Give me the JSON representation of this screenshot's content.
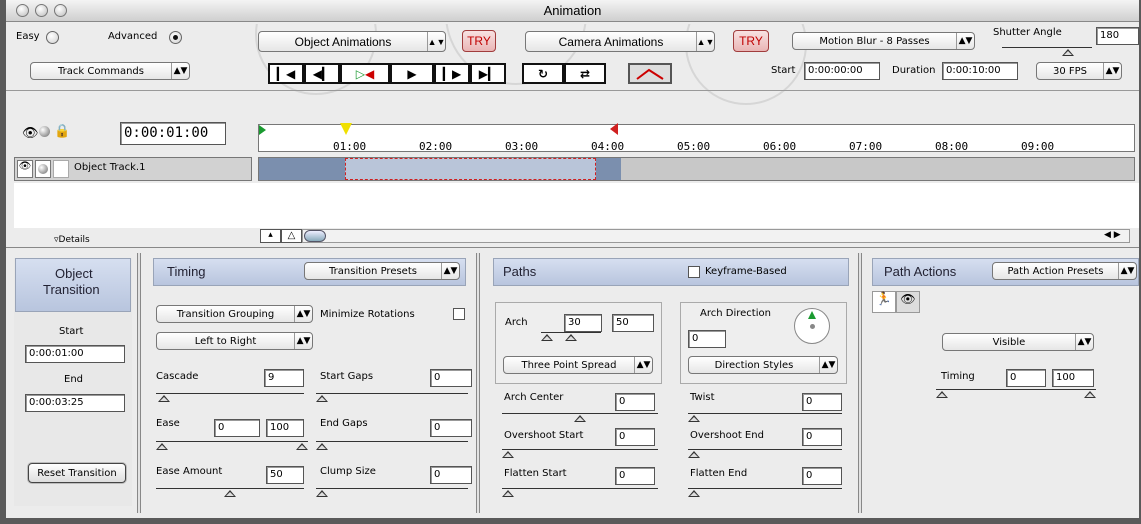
{
  "window": {
    "title": "Animation"
  },
  "mode": {
    "easy_label": "Easy",
    "advanced_label": "Advanced",
    "selected": "Advanced"
  },
  "toolbar": {
    "object_animations": "Object Animations",
    "camera_animations": "Camera Animations",
    "try_label": "TRY",
    "motion_blur": "Motion Blur - 8 Passes",
    "shutter_angle_label": "Shutter Angle",
    "shutter_angle_value": "180",
    "track_commands": "Track Commands",
    "start_label": "Start",
    "start_value": "0:00:00:00",
    "duration_label": "Duration",
    "duration_value": "0:00:10:00",
    "fps": "30 FPS"
  },
  "timeline": {
    "current_time": "0:00:01:00",
    "ticks": [
      "01:00",
      "02:00",
      "03:00",
      "04:00",
      "05:00",
      "06:00",
      "07:00",
      "08:00",
      "09:00"
    ],
    "track_name": "Object Track.1",
    "details_label": "Details"
  },
  "object_transition": {
    "title_line1": "Object",
    "title_line2": "Transition",
    "start_label": "Start",
    "start_value": "0:00:01:00",
    "end_label": "End",
    "end_value": "0:00:03:25",
    "reset_button": "Reset Transition"
  },
  "timing": {
    "title": "Timing",
    "presets": "Transition Presets",
    "grouping": "Transition Grouping",
    "minimize_rotations": "Minimize Rotations",
    "order": "Left to Right",
    "cascade_label": "Cascade",
    "cascade_value": "9",
    "start_gaps_label": "Start Gaps",
    "start_gaps_value": "0",
    "ease_label": "Ease",
    "ease_value_a": "0",
    "ease_value_b": "100",
    "end_gaps_label": "End Gaps",
    "end_gaps_value": "0",
    "ease_amount_label": "Ease Amount",
    "ease_amount_value": "50",
    "clump_size_label": "Clump Size",
    "clump_size_value": "0"
  },
  "paths": {
    "title": "Paths",
    "keyframe_based": "Keyframe-Based",
    "arch_label": "Arch",
    "arch_value_a": "30",
    "arch_value_b": "50",
    "arch_direction_label": "Arch Direction",
    "arch_direction_value": "0",
    "three_point_spread": "Three Point Spread",
    "direction_styles": "Direction Styles",
    "arch_center_label": "Arch Center",
    "arch_center_value": "0",
    "twist_label": "Twist",
    "twist_value": "0",
    "overshoot_start_label": "Overshoot Start",
    "overshoot_start_value": "0",
    "overshoot_end_label": "Overshoot End",
    "overshoot_end_value": "0",
    "flatten_start_label": "Flatten Start",
    "flatten_start_value": "0",
    "flatten_end_label": "Flatten End",
    "flatten_end_value": "0"
  },
  "path_actions": {
    "title": "Path Actions",
    "presets": "Path Action Presets",
    "visible": "Visible",
    "timing_label": "Timing",
    "timing_value_a": "0",
    "timing_value_b": "100"
  },
  "colors": {
    "track_bar": "#7b8fae",
    "try_text": "#c00000",
    "panel_header": "#c3cde3"
  }
}
